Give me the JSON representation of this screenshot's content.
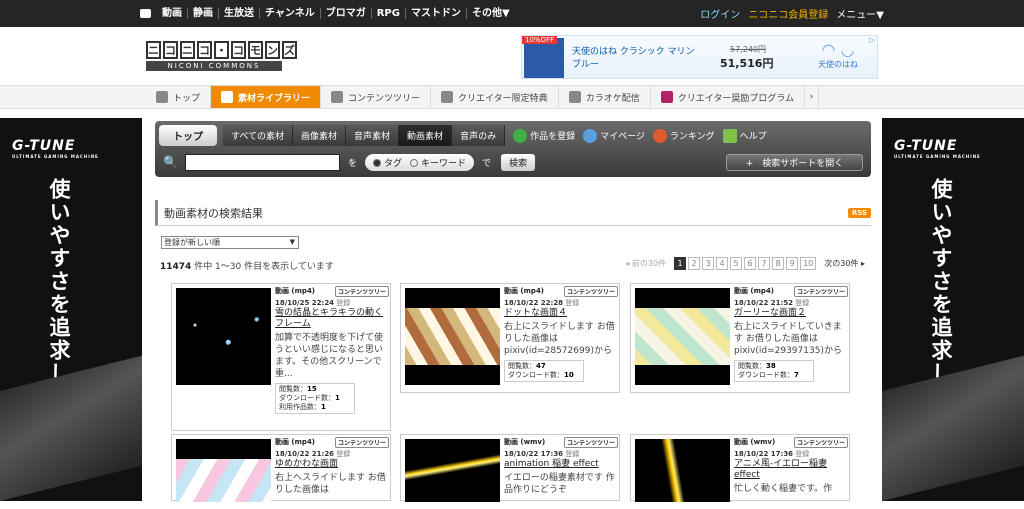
{
  "global_bar": {
    "left_items": [
      "動画",
      "静画",
      "生放送",
      "チャンネル",
      "ブロマガ",
      "RPG",
      "マストドン",
      "その他▼"
    ],
    "login": "ログイン",
    "premium": "ニコニコ会員登録",
    "menu": "メニュー▼"
  },
  "logo": {
    "main": "ニコニコ・コモンズ",
    "sub": "NICONI COMMONS",
    "chars": [
      "ニ",
      "コ",
      "ニ",
      "コ",
      "・",
      "コ",
      "モ",
      "ン",
      "ズ"
    ]
  },
  "ad": {
    "badge": "10%OFF",
    "title": "天使のはね クラシック マリン ブルー",
    "old_price": "57,240円",
    "price": "51,516円",
    "brand": "天使のはね"
  },
  "nav": {
    "items": [
      "トップ",
      "素材ライブラリー",
      "コンテンツツリー",
      "クリエイター限定特典",
      "カラオケ配信",
      "クリエイター奨励プログラム"
    ],
    "more": "›"
  },
  "side_banner": {
    "brand": "G-TUNE",
    "brand_sub": "ULTIMATE GAMING MACHINE",
    "copy": "使いやすさを追求した"
  },
  "toolbar": {
    "top": "トップ",
    "tabs": [
      "すべての素材",
      "画像素材",
      "音声素材",
      "動画素材",
      "音声のみ"
    ],
    "actions": [
      "作品を登録",
      "マイページ",
      "ランキング",
      "ヘルプ"
    ],
    "search_value": "",
    "wo": "を",
    "radio_tag": "タグ",
    "radio_keyword": "キーワード",
    "de": "で",
    "search_btn": "検索",
    "support": "+　検索サポートを開く"
  },
  "results": {
    "heading": "動画素材の検索結果",
    "rss": "RSS",
    "sort": "登録が新しい順",
    "total": "11474",
    "count_text": "件中 1〜30 件目を表示しています",
    "prev": "◂ 前の30件",
    "pages": [
      "1",
      "2",
      "3",
      "4",
      "5",
      "6",
      "7",
      "8",
      "9",
      "10"
    ],
    "next": "次の30件 ▸"
  },
  "cards": [
    {
      "type": "動画 (mp4)",
      "badge": "コンテンツツリー",
      "date": "18/10/25 22:24",
      "reg": "登録",
      "title": "雪の結晶とキラキラの動くフレーム",
      "desc": "加算で不透明度を下げて使うといい感じになると思います。その他スクリーンで重...",
      "views_label": "閲覧数：",
      "views": "15",
      "dl_label": "ダウンロード数：",
      "dl": "1",
      "use_label": "利用作品数：",
      "use": "1"
    },
    {
      "type": "動画 (mp4)",
      "badge": "コンテンツツリー",
      "date": "18/10/22 22:28",
      "reg": "登録",
      "title": "ドットな画面４",
      "desc": "右上にスライドします お借りした画像は pixiv(id=28572699)から",
      "views_label": "閲覧数：",
      "views": "47",
      "dl_label": "ダウンロード数：",
      "dl": "10"
    },
    {
      "type": "動画 (mp4)",
      "badge": "コンテンツツリー",
      "date": "18/10/22 21:52",
      "reg": "登録",
      "title": "ガーリーな画面２",
      "desc": "右上にスライドしていきます お借りした画像は pixiv(id=29397135)から",
      "views_label": "閲覧数：",
      "views": "38",
      "dl_label": "ダウンロード数：",
      "dl": "7"
    },
    {
      "type": "動画 (mp4)",
      "badge": "コンテンツツリー",
      "date": "18/10/22 21:26",
      "reg": "登録",
      "title": "ゆめかわな画面",
      "desc": "右上へスライドします お借りした画像は"
    },
    {
      "type": "動画 (wmv)",
      "badge": "コンテンツツリー",
      "date": "18/10/22 17:36",
      "reg": "登録",
      "title": "animation 稲妻 effect",
      "desc": "イエローの稲妻素材です 作品作りにどうぞ"
    },
    {
      "type": "動画 (wmv)",
      "badge": "コンテンツツリー",
      "date": "18/10/22 17:36",
      "reg": "登録",
      "title": "アニメ風-イエロー稲妻 effect",
      "desc": "忙しく動く稲妻です。作"
    }
  ]
}
